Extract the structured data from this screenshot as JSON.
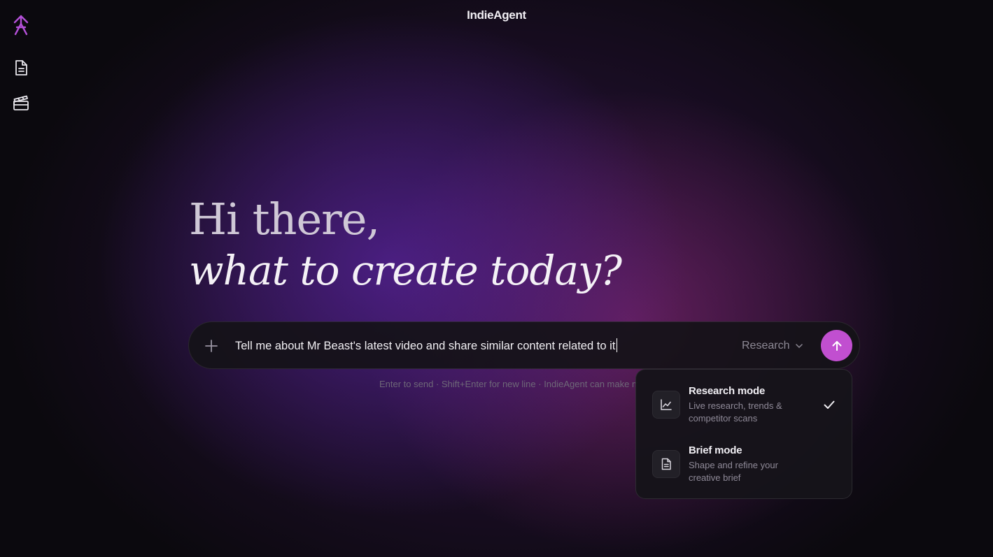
{
  "app": {
    "title": "IndieAgent"
  },
  "sidebar": {
    "logo_icon": "indieagent-logo-icon",
    "items": [
      {
        "icon": "document-icon"
      },
      {
        "icon": "clapperboard-icon"
      }
    ]
  },
  "hero": {
    "line1": "Hi there,",
    "line2": "what to create today?"
  },
  "composer": {
    "attach_icon": "plus-icon",
    "input_value": "Tell me about Mr Beast's latest video and share similar content related to it",
    "mode_label": "Research",
    "send_icon": "arrow-up-icon",
    "hint": "Enter to send · Shift+Enter for new line · IndieAgent can make mistakes"
  },
  "mode_menu": {
    "items": [
      {
        "title": "Research mode",
        "desc": "Live research, trends & competitor scans",
        "icon": "line-chart-icon",
        "selected": true
      },
      {
        "title": "Brief mode",
        "desc": "Shape and refine your creative brief",
        "icon": "document-icon",
        "selected": false
      }
    ]
  },
  "colors": {
    "accent": "#c14fd0",
    "logo": "#b450d8",
    "background": "#0b090e",
    "glow_purple": "#542296",
    "glow_magenta": "#8c2878"
  }
}
